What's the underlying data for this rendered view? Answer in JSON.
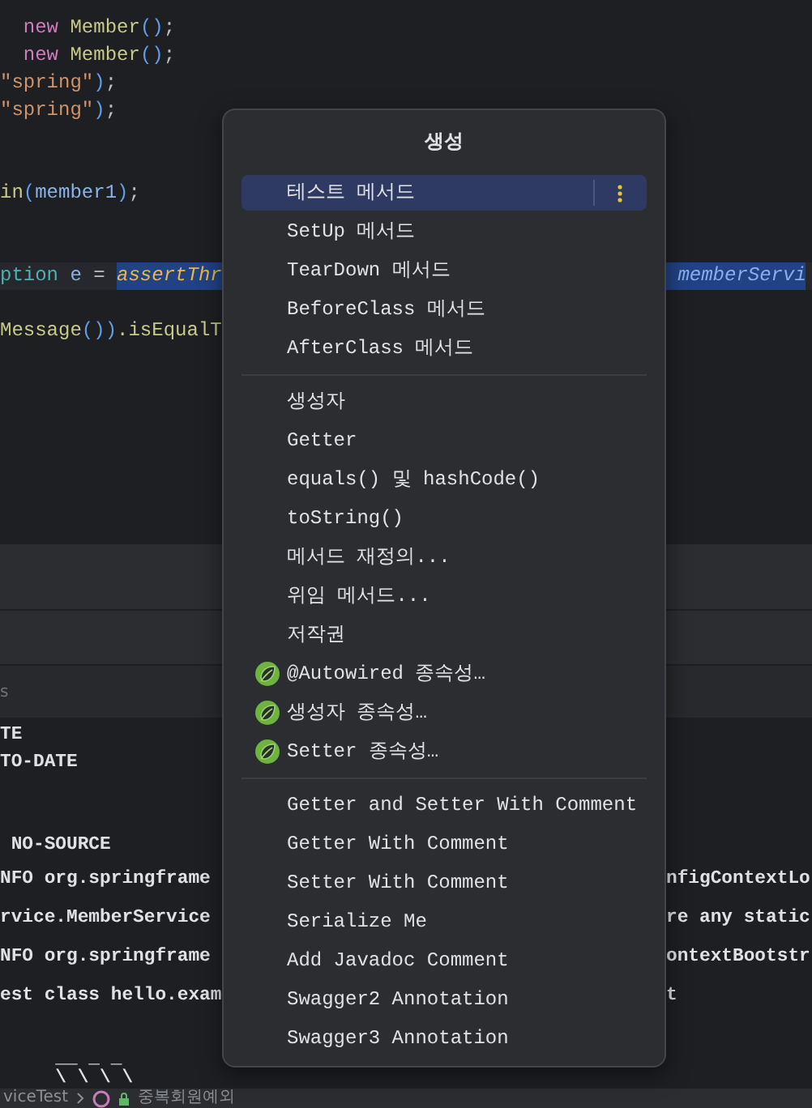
{
  "editor": {
    "lines": [
      {
        "current": false,
        "tokens": [
          {
            "text": "  new ",
            "kind": "keyword",
            "selected": false
          },
          {
            "text": "Member",
            "kind": "type",
            "selected": false
          },
          {
            "text": "()",
            "kind": "paren",
            "selected": false
          },
          {
            "text": ";",
            "kind": "plain",
            "selected": false
          }
        ]
      },
      {
        "current": false,
        "tokens": [
          {
            "text": "  new ",
            "kind": "keyword",
            "selected": false
          },
          {
            "text": "Member",
            "kind": "type",
            "selected": false
          },
          {
            "text": "()",
            "kind": "paren",
            "selected": false
          },
          {
            "text": ";",
            "kind": "plain",
            "selected": false
          }
        ]
      },
      {
        "current": false,
        "tokens": [
          {
            "text": "\"spring\"",
            "kind": "string",
            "selected": false
          },
          {
            "text": ")",
            "kind": "paren",
            "selected": false
          },
          {
            "text": ";",
            "kind": "plain",
            "selected": false
          }
        ]
      },
      {
        "current": false,
        "tokens": [
          {
            "text": "\"spring\"",
            "kind": "string",
            "selected": false
          },
          {
            "text": ")",
            "kind": "paren",
            "selected": false
          },
          {
            "text": ";",
            "kind": "plain",
            "selected": false
          }
        ]
      },
      {
        "current": false,
        "tokens": [
          {
            "text": "in",
            "kind": "method",
            "selected": false
          },
          {
            "text": "(",
            "kind": "paren",
            "selected": false
          },
          {
            "text": "member1",
            "kind": "ident",
            "selected": false
          },
          {
            "text": ")",
            "kind": "paren",
            "selected": false
          },
          {
            "text": ";",
            "kind": "plain",
            "selected": false
          }
        ]
      },
      {
        "current": true,
        "tokens": [
          {
            "text": "ption ",
            "kind": "class",
            "selected": false
          },
          {
            "text": "e",
            "kind": "ident",
            "selected": false
          },
          {
            "text": " = ",
            "kind": "plain",
            "selected": false
          },
          {
            "text": "assertThr",
            "kind": "static",
            "selected": true
          }
        ],
        "right": [
          {
            "text": " memberServi",
            "kind": "field",
            "selected": true
          }
        ]
      },
      {
        "current": false,
        "tokens": [
          {
            "text": "Message",
            "kind": "method",
            "selected": false
          },
          {
            "text": "())",
            "kind": "paren",
            "selected": false
          },
          {
            "text": ".isEqualT",
            "kind": "method",
            "selected": false
          }
        ]
      }
    ]
  },
  "panel_label": "s",
  "console": {
    "lines": [
      {
        "left": "TE"
      },
      {
        "left": "TO-DATE"
      },
      {
        "left": " NO-SOURCE"
      },
      {
        "left": "NFO org.springframe",
        "right": "nfigContextLo"
      },
      {
        "left": "rvice.MemberService",
        "right": "re any static"
      },
      {
        "left": "NFO org.springframe",
        "right": "ontextBootstr"
      },
      {
        "left": "est class hello.exam",
        "right": "t"
      },
      {
        "left": "     __ _ _"
      },
      {
        "left": "     \\ \\ \\ \\"
      }
    ]
  },
  "breadcrumb": {
    "file": "viceTest",
    "method": "중복회원예외"
  },
  "popup": {
    "title": "생성",
    "sections": [
      {
        "items": [
          {
            "label": "테스트 메서드",
            "kind": "plain",
            "selected": true
          },
          {
            "label": "SetUp 메서드",
            "kind": "plain",
            "selected": false
          },
          {
            "label": "TearDown 메서드",
            "kind": "plain",
            "selected": false
          },
          {
            "label": "BeforeClass 메서드",
            "kind": "plain",
            "selected": false
          },
          {
            "label": "AfterClass 메서드",
            "kind": "plain",
            "selected": false
          }
        ]
      },
      {
        "items": [
          {
            "label": "생성자",
            "kind": "plain",
            "selected": false
          },
          {
            "label": "Getter",
            "kind": "plain",
            "selected": false
          },
          {
            "label": "equals() 및 hashCode()",
            "kind": "plain",
            "selected": false
          },
          {
            "label": "toString()",
            "kind": "plain",
            "selected": false
          },
          {
            "label": "메서드 재정의...",
            "kind": "plain",
            "selected": false
          },
          {
            "label": "위임 메서드...",
            "kind": "plain",
            "selected": false
          },
          {
            "label": "저작권",
            "kind": "plain",
            "selected": false
          },
          {
            "label": "@Autowired 종속성…",
            "kind": "spring",
            "selected": false
          },
          {
            "label": "생성자 종속성…",
            "kind": "spring",
            "selected": false
          },
          {
            "label": "Setter 종속성…",
            "kind": "spring",
            "selected": false
          }
        ]
      },
      {
        "items": [
          {
            "label": "Getter and Setter With Comment",
            "kind": "plain",
            "selected": false
          },
          {
            "label": "Getter With Comment",
            "kind": "plain",
            "selected": false
          },
          {
            "label": "Setter With Comment",
            "kind": "plain",
            "selected": false
          },
          {
            "label": "Serialize Me",
            "kind": "plain",
            "selected": false
          },
          {
            "label": "Add Javadoc Comment",
            "kind": "plain",
            "selected": false
          },
          {
            "label": "Swagger2 Annotation",
            "kind": "plain",
            "selected": false
          },
          {
            "label": "Swagger3 Annotation",
            "kind": "plain",
            "selected": false
          }
        ]
      }
    ]
  }
}
